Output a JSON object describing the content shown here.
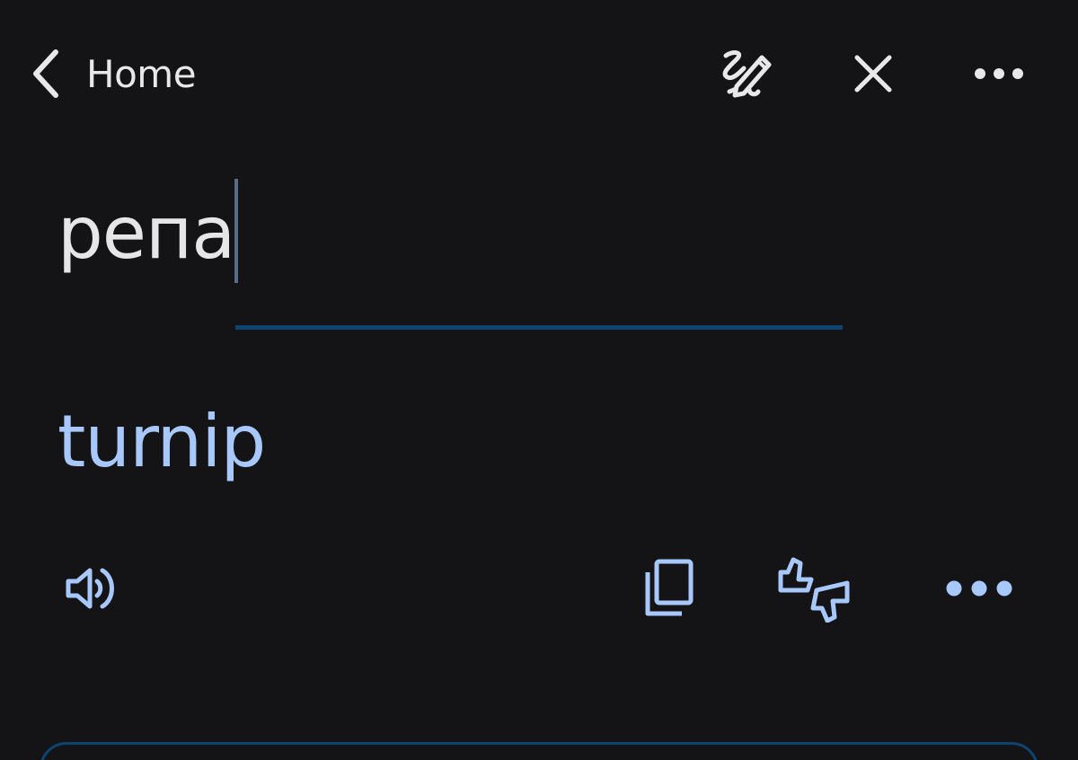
{
  "header": {
    "back_label": "Home"
  },
  "source": {
    "text": "репа"
  },
  "translation": {
    "text": "turnip"
  },
  "colors": {
    "background": "#141416",
    "text_primary": "#e6e6e8",
    "accent": "#a8c7fa",
    "underline": "#0d4470"
  },
  "icons": {
    "back": "chevron-left-icon",
    "handwriting": "handwriting-pen-icon",
    "close": "close-icon",
    "header_more": "more-horizontal-icon",
    "speaker": "speaker-icon",
    "copy": "copy-icon",
    "feedback": "thumbs-up-down-icon",
    "actions_more": "more-horizontal-icon"
  }
}
